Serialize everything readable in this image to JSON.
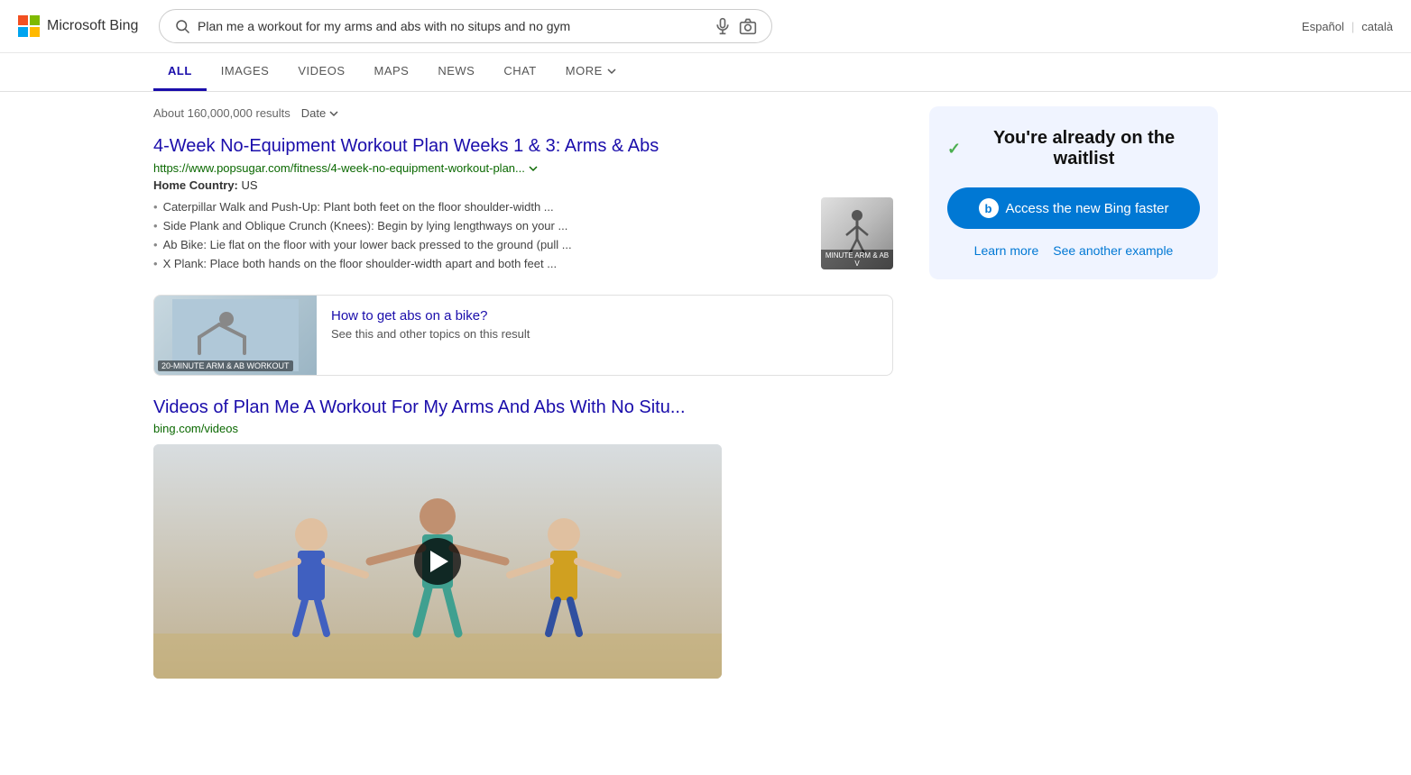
{
  "header": {
    "logo_text": "Microsoft Bing",
    "search_query": "Plan me a workout for my arms and abs with no situps and no gym",
    "lang1": "Español",
    "lang2": "català",
    "lang_sep": "|"
  },
  "nav": {
    "tabs": [
      {
        "id": "all",
        "label": "ALL",
        "active": true
      },
      {
        "id": "images",
        "label": "IMAGES",
        "active": false
      },
      {
        "id": "videos",
        "label": "VIDEOS",
        "active": false
      },
      {
        "id": "maps",
        "label": "MAPS",
        "active": false
      },
      {
        "id": "news",
        "label": "NEWS",
        "active": false
      },
      {
        "id": "chat",
        "label": "CHAT",
        "active": false
      },
      {
        "id": "more",
        "label": "MORE",
        "active": false
      }
    ]
  },
  "results": {
    "count_text": "About 160,000,000 results",
    "date_filter": "Date",
    "first_result": {
      "title": "4-Week No-Equipment Workout Plan Weeks 1 & 3: Arms & Abs",
      "url": "https://www.popsugar.com/fitness/4-week-no-equipment-workout-plan...",
      "home_country_label": "Home Country:",
      "home_country_value": "US",
      "bullets": [
        "Caterpillar Walk and Push-Up: Plant both feet on the floor shoulder-width ...",
        "Side Plank and Oblique Crunch (Knees): Begin by lying lengthways on your ...",
        "Ab Bike: Lie flat on the floor with your lower back pressed to the ground (pull ...",
        "X Plank: Place both hands on the floor shoulder-width apart and both feet ..."
      ],
      "thumb_label": "MINUTE ARM & AB V"
    },
    "how_to": {
      "question": "How to get abs on a bike?",
      "sub": "See this and other topics on this result",
      "image_label": "20-MINUTE ARM & AB WORKOUT"
    },
    "videos_section": {
      "title": "Videos of Plan Me A Workout For My Arms And Abs With No Situ...",
      "url": "bing.com/videos"
    }
  },
  "sidebar": {
    "waitlist_title": "You're already on the waitlist",
    "waitlist_check": "✓",
    "access_button_label": "Access the new Bing faster",
    "bing_b": "b",
    "learn_more": "Learn more",
    "see_another": "See another example"
  }
}
